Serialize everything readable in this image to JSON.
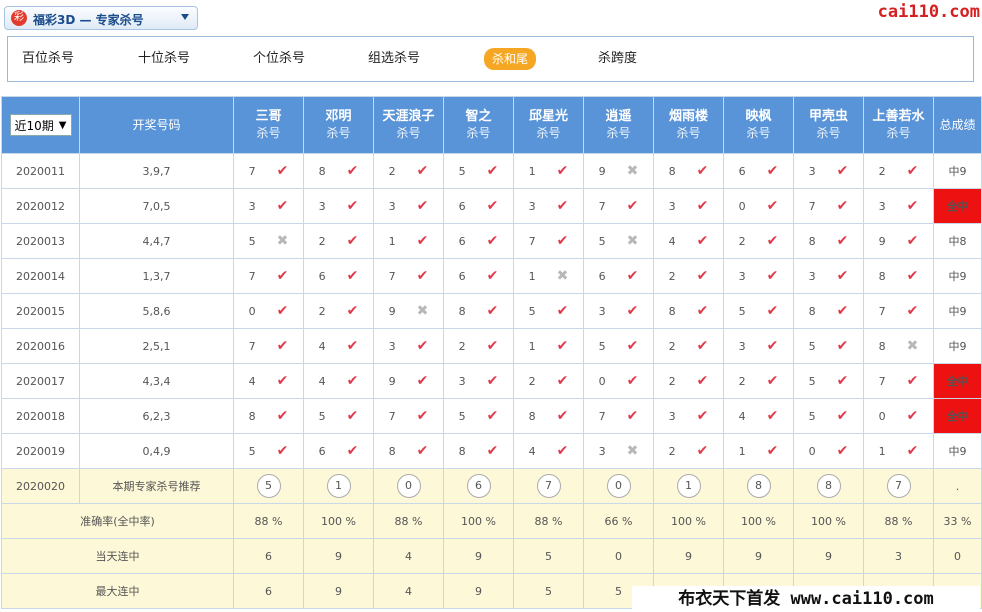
{
  "header": {
    "logo_glyph": "彩",
    "lottery_selector": "福彩3D — 专家杀号",
    "brand": "cai110.com"
  },
  "tabs": [
    {
      "label": "百位杀号",
      "active": false
    },
    {
      "label": "十位杀号",
      "active": false
    },
    {
      "label": "个位杀号",
      "active": false
    },
    {
      "label": "组选杀号",
      "active": false
    },
    {
      "label": "杀和尾",
      "active": true
    },
    {
      "label": "杀跨度",
      "active": false
    }
  ],
  "table": {
    "period_select": "近10期",
    "draw_header": "开奖号码",
    "total_header": "总成绩",
    "kill_sub": "杀号",
    "experts": [
      "三哥",
      "邓明",
      "天涯浪子",
      "智之",
      "邱星光",
      "逍遥",
      "烟雨楼",
      "映枫",
      "甲壳虫",
      "上善若水"
    ],
    "rows": [
      {
        "period": "2020011",
        "draw": "3,9,7",
        "kills": [
          "7",
          "8",
          "2",
          "5",
          "1",
          "9",
          "8",
          "6",
          "3",
          "2"
        ],
        "hits": [
          true,
          true,
          true,
          true,
          true,
          false,
          true,
          true,
          true,
          true
        ],
        "total": "中9"
      },
      {
        "period": "2020012",
        "draw": "7,0,5",
        "kills": [
          "3",
          "3",
          "3",
          "6",
          "3",
          "7",
          "3",
          "0",
          "7",
          "3"
        ],
        "hits": [
          true,
          true,
          true,
          true,
          true,
          true,
          true,
          true,
          true,
          true
        ],
        "total": "全中"
      },
      {
        "period": "2020013",
        "draw": "4,4,7",
        "kills": [
          "5",
          "2",
          "1",
          "6",
          "7",
          "5",
          "4",
          "2",
          "8",
          "9"
        ],
        "hits": [
          false,
          true,
          true,
          true,
          true,
          false,
          true,
          true,
          true,
          true
        ],
        "total": "中8"
      },
      {
        "period": "2020014",
        "draw": "1,3,7",
        "kills": [
          "7",
          "6",
          "7",
          "6",
          "1",
          "6",
          "2",
          "3",
          "3",
          "8"
        ],
        "hits": [
          true,
          true,
          true,
          true,
          false,
          true,
          true,
          true,
          true,
          true
        ],
        "total": "中9"
      },
      {
        "period": "2020015",
        "draw": "5,8,6",
        "kills": [
          "0",
          "2",
          "9",
          "8",
          "5",
          "3",
          "8",
          "5",
          "8",
          "7"
        ],
        "hits": [
          true,
          true,
          false,
          true,
          true,
          true,
          true,
          true,
          true,
          true
        ],
        "total": "中9"
      },
      {
        "period": "2020016",
        "draw": "2,5,1",
        "kills": [
          "7",
          "4",
          "3",
          "2",
          "1",
          "5",
          "2",
          "3",
          "5",
          "8"
        ],
        "hits": [
          true,
          true,
          true,
          true,
          true,
          true,
          true,
          true,
          true,
          false
        ],
        "total": "中9"
      },
      {
        "period": "2020017",
        "draw": "4,3,4",
        "kills": [
          "4",
          "4",
          "9",
          "3",
          "2",
          "0",
          "2",
          "2",
          "5",
          "7"
        ],
        "hits": [
          true,
          true,
          true,
          true,
          true,
          true,
          true,
          true,
          true,
          true
        ],
        "total": "全中"
      },
      {
        "period": "2020018",
        "draw": "6,2,3",
        "kills": [
          "8",
          "5",
          "7",
          "5",
          "8",
          "7",
          "3",
          "4",
          "5",
          "0"
        ],
        "hits": [
          true,
          true,
          true,
          true,
          true,
          true,
          true,
          true,
          true,
          true
        ],
        "total": "全中"
      },
      {
        "period": "2020019",
        "draw": "0,4,9",
        "kills": [
          "5",
          "6",
          "8",
          "8",
          "4",
          "3",
          "2",
          "1",
          "0",
          "1"
        ],
        "hits": [
          true,
          true,
          true,
          true,
          true,
          false,
          true,
          true,
          true,
          true
        ],
        "total": "中9"
      }
    ],
    "recommend": {
      "period": "2020020",
      "label": "本期专家杀号推荐",
      "picks": [
        "5",
        "1",
        "0",
        "6",
        "7",
        "0",
        "1",
        "8",
        "8",
        "7"
      ],
      "total": "."
    },
    "stats": [
      {
        "label": "准确率(全中率)",
        "values": [
          "88 %",
          "100 %",
          "88 %",
          "100 %",
          "88 %",
          "66 %",
          "100 %",
          "100 %",
          "100 %",
          "88 %"
        ],
        "total": "33 %"
      },
      {
        "label": "当天连中",
        "values": [
          "6",
          "9",
          "4",
          "9",
          "5",
          "0",
          "9",
          "9",
          "9",
          "3"
        ],
        "total": "0"
      },
      {
        "label": "最大连中",
        "values": [
          "6",
          "9",
          "4",
          "9",
          "5",
          "5",
          "",
          "",
          "",
          ""
        ],
        "total": ""
      }
    ]
  },
  "footer_banner": "布衣天下首发 www.cai110.com"
}
